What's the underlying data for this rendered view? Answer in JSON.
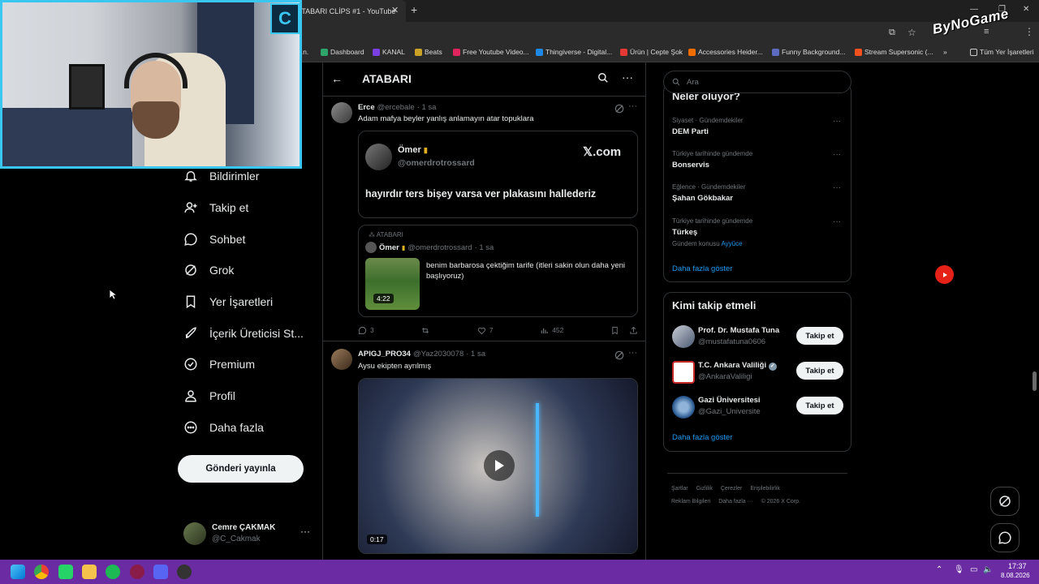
{
  "browser": {
    "tab_title": "ATABARI CLİPS #1 - YouTube",
    "bookmarks": [
      {
        "label": "Dashboard",
        "color": "#2fa36b"
      },
      {
        "label": "KANAL",
        "color": "#7b3fe4"
      },
      {
        "label": "Beats",
        "color": "#c9a227"
      },
      {
        "label": "Free Youtube Video...",
        "color": "#e0245e"
      },
      {
        "label": "Thingiverse - Digital...",
        "color": "#1e88e5"
      },
      {
        "label": "Ürün | Cepte Şok",
        "color": "#e53935"
      },
      {
        "label": "Accessories Heider...",
        "color": "#ef6c00"
      },
      {
        "label": "Funny Background...",
        "color": "#5c6bc0"
      },
      {
        "label": "Stream Supersonic (...",
        "color": "#f4511e"
      }
    ],
    "all_bookmarks_label": "Tüm Yer İşaretleri",
    "overlay_logo": "ByNoGame"
  },
  "nav": {
    "items": [
      {
        "label": "Bildirimler",
        "icon": "bell-icon"
      },
      {
        "label": "Takip et",
        "icon": "follow-icon"
      },
      {
        "label": "Sohbet",
        "icon": "chat-icon"
      },
      {
        "label": "Grok",
        "icon": "grok-icon"
      },
      {
        "label": "Yer İşaretleri",
        "icon": "bookmark-icon"
      },
      {
        "label": "İçerik Üreticisi St...",
        "icon": "rocket-icon"
      },
      {
        "label": "Premium",
        "icon": "premium-icon"
      },
      {
        "label": "Profil",
        "icon": "profile-icon"
      },
      {
        "label": "Daha fazla",
        "icon": "more-icon"
      }
    ],
    "post_button": "Gönderi yayınla",
    "account": {
      "name": "Cemre ÇAKMAK",
      "handle": "@C_Cakmak"
    }
  },
  "header": {
    "title": "ATABARI"
  },
  "posts": [
    {
      "name": "Erce",
      "handle": "@ercebale",
      "time": "· 1 sa",
      "text": "Adam mafya beyler yanlış anlamayın atar topuklara",
      "embed": {
        "name": "Ömer",
        "handle": "@omerdrotrossard",
        "brand": "𝕏.com",
        "text": "hayırdır ters bişey varsa ver plakasını hallederiz"
      },
      "quote": {
        "community": "ATABARI",
        "name": "Ömer",
        "handle": "@omerdrotrossard",
        "time": "· 1 sa",
        "text": "benim barbarosa çektiğim tarife (itleri sakin olun daha yeni başlıyoruz)",
        "duration": "4:22"
      },
      "stats": {
        "replies": "3",
        "likes": "7",
        "views": "452"
      }
    },
    {
      "name": "APIGJ_PRO34",
      "handle": "@Yaz2030078",
      "time": "· 1 sa",
      "text": "Aysu ekipten ayrılmış",
      "video_duration": "0:17"
    }
  ],
  "right": {
    "search_placeholder": "Ara",
    "trends_title": "Neler oluyor?",
    "trends": [
      {
        "category": "Siyaset · Gündemdekiler",
        "name": "DEM Parti"
      },
      {
        "category": "Türkiye tarihinde gündemde",
        "name": "Bonservis"
      },
      {
        "category": "Eğlence · Gündemdekiler",
        "name": "Şahan Gökbakar"
      },
      {
        "category": "Türkiye tarihinde gündemde",
        "name": "Türkeş",
        "sub": "Gündem konusu",
        "sub_link": "Ayyüce"
      }
    ],
    "show_more": "Daha fazla göster",
    "wtf_title": "Kimi takip etmeli",
    "wtf": [
      {
        "name": "Prof. Dr. Mustafa Tuna",
        "handle": "@mustafatuna0606",
        "button": "Takip et"
      },
      {
        "name": "T.C. Ankara Valiliği",
        "handle": "@AnkaraValiligi",
        "button": "Takip et",
        "verified": true
      },
      {
        "name": "Gazi Üniversitesi",
        "handle": "@Gazi_Universite",
        "button": "Takip et"
      }
    ],
    "wtf_more": "Daha fazla göster",
    "footer_row1": [
      "Şartlar",
      "Gizlilik",
      "Çerezler",
      "Erişilebilirlik"
    ],
    "footer_row2": [
      "Reklam Bilgileri",
      "Daha fazla ···",
      "© 2026 X Corp."
    ]
  },
  "taskbar": {
    "time": "17:37",
    "date": "8.08.2026"
  },
  "colors": {
    "accent": "#1d9bf0",
    "webcam_border": "#39c6f0",
    "taskbar": "#6b2ca3"
  }
}
